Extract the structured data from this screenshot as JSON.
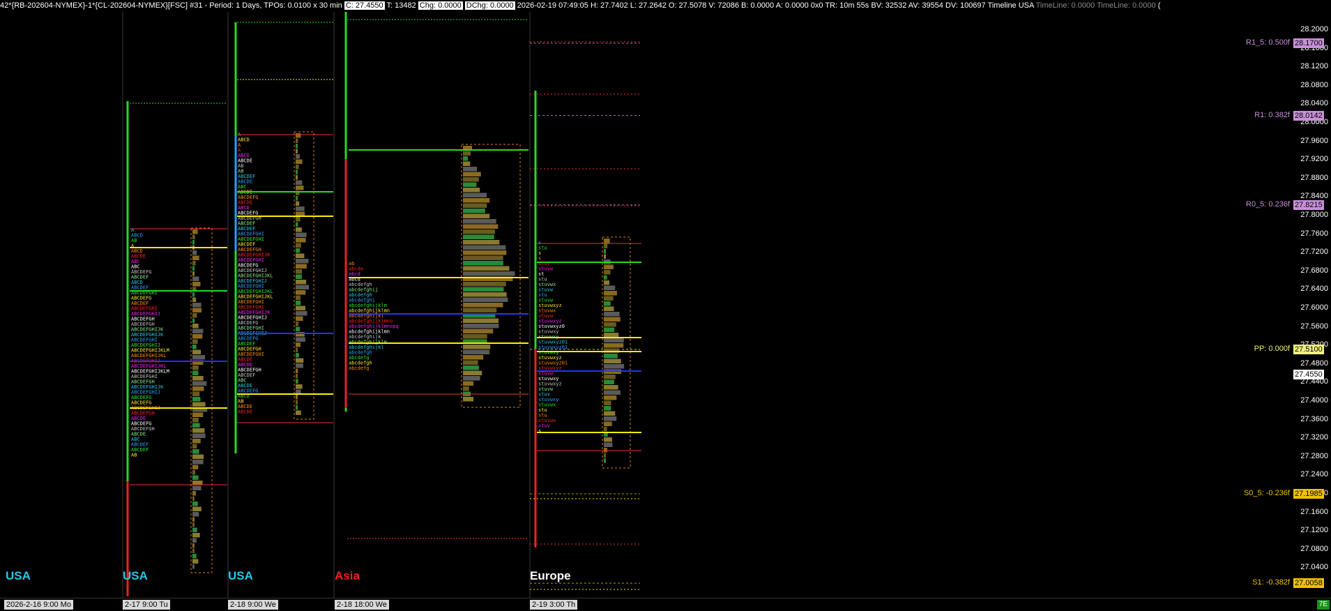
{
  "header": {
    "pre": "42*{RB-202604-NYMEX}-1*{CL-202604-NYMEX}[FSC] #31 - Period: 1 Days, TPOs: 0.0100 x 30 min",
    "close": "C: 27.4550",
    "trades": "T: 13482",
    "chg": "Chg: 0.0000",
    "dchg": "DChg: 0.0000",
    "post": "2026-02-19 07:49:05 H: 27.7402 L: 27.2642 O: 27.5078 V: 72086 B: 0.0000 A: 0.0000 0x0 TR: 10m 55s BV: 32532 AV: 39554 DV: 100697 Timeline USA",
    "timeline_a": "TimeLine: 0.0000",
    "timeline_b": "TimeLine: 0.0000",
    "end": "("
  },
  "price_axis": {
    "ticks": [
      "28.2000",
      "28.1600",
      "28.1200",
      "28.0800",
      "28.0400",
      "28.0000",
      "27.9600",
      "27.9200",
      "27.8800",
      "27.8400",
      "27.8000",
      "27.7600",
      "27.7200",
      "27.6800",
      "27.6400",
      "27.6000",
      "27.5600",
      "27.5200",
      "27.4800",
      "27.4400",
      "27.4000",
      "27.3600",
      "27.3200",
      "27.2800",
      "27.2400",
      "27.2000",
      "27.1600",
      "27.1200",
      "27.0800",
      "27.0400"
    ],
    "current_price": "27.4550"
  },
  "levels": [
    {
      "label": "R1_5: 0.500f",
      "value": "28.1700",
      "color": "#c890d8"
    },
    {
      "label": "R1: 0.382f",
      "value": "28.0142",
      "color": "#c890d8"
    },
    {
      "label": "R0_5: 0.236f",
      "value": "27.8215",
      "color": "#c890d8"
    },
    {
      "label": "PP: 0.000f",
      "value": "27.5100",
      "color": "#f0f080"
    },
    {
      "label": "S0_5: -0.236f",
      "value": "27.1985",
      "color": "#f0c000"
    },
    {
      "label": "S1: -0.382f",
      "value": "27.0058",
      "color": "#f0c000"
    }
  ],
  "sessions": [
    {
      "name": "USA",
      "date": "2026-2-16  9:00 Mo",
      "color": "#25c8e8"
    },
    {
      "name": "USA",
      "date": "2-17  9:00 Tu",
      "color": "#25c8e8"
    },
    {
      "name": "USA",
      "date": "2-18  9:00 We",
      "color": "#25c8e8"
    },
    {
      "name": "Asia",
      "date": "2-18  18:00 We",
      "color": "#ee2222"
    },
    {
      "name": "Europe",
      "date": "2-19  3:00 Th",
      "color": "#ffffff"
    }
  ],
  "profile_glyphs": [
    "ABCDEFGHIJKLMNO",
    "ABCDEFGHIJKLMNOPQ",
    "abcdefghijklmnopqr",
    "stuvwxyz01"
  ],
  "badge": "7E"
}
